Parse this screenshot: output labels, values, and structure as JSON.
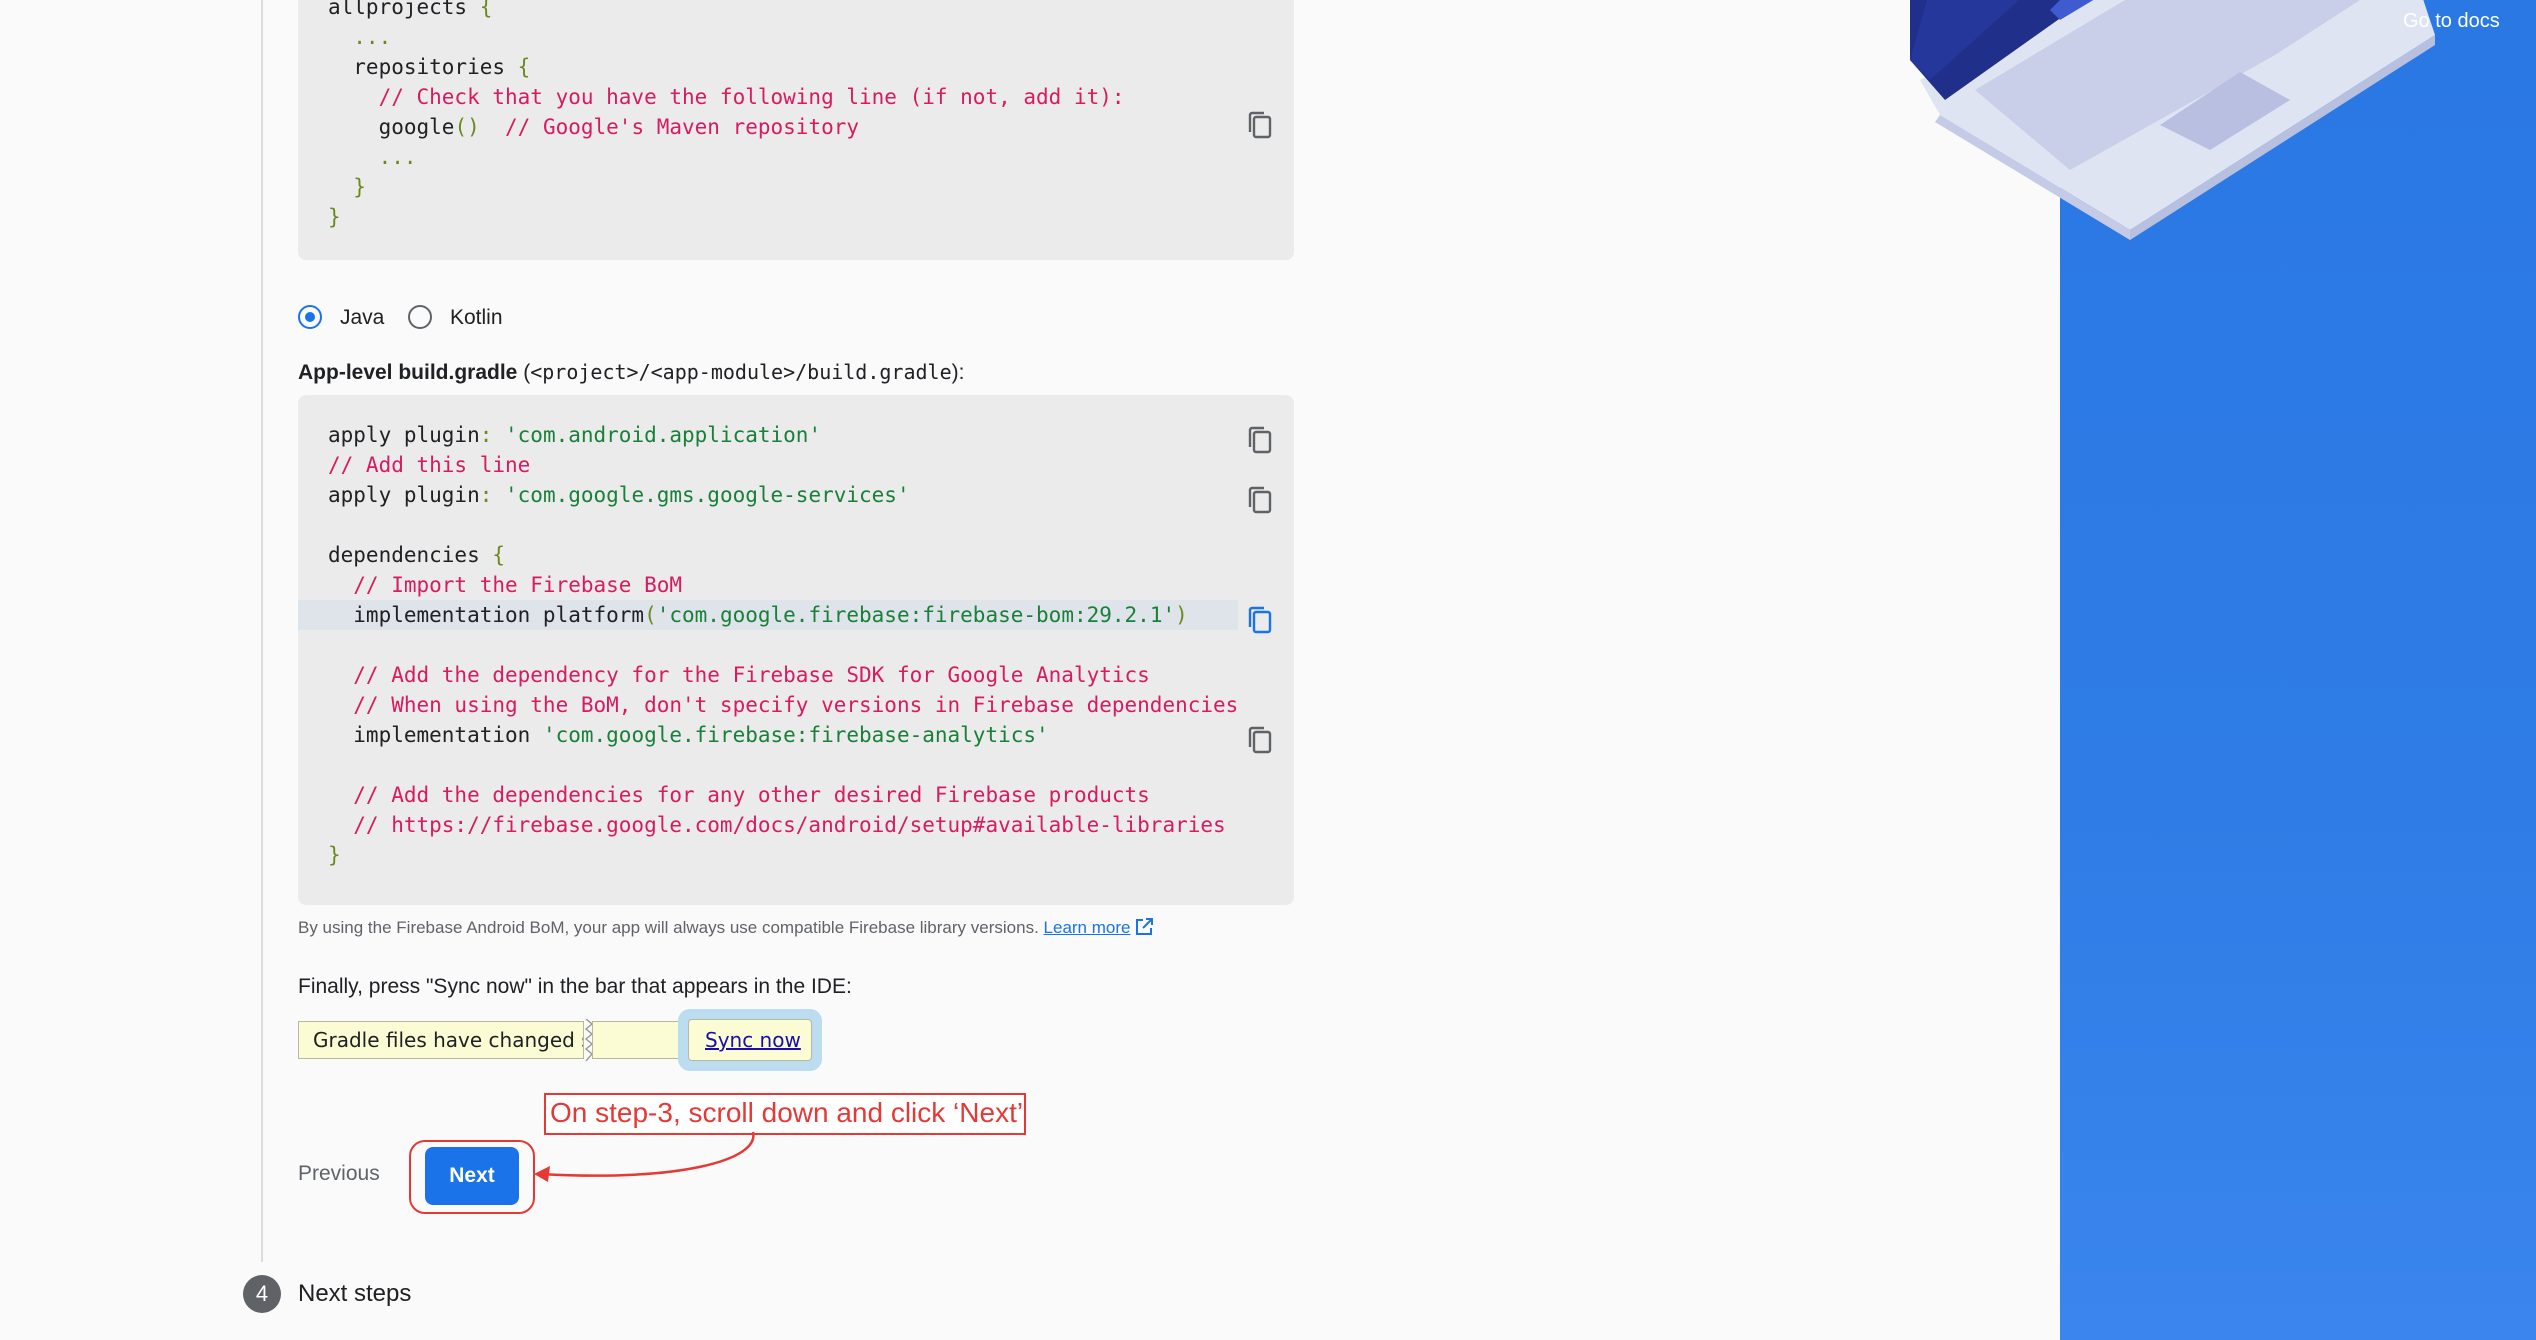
{
  "header": {
    "goto_docs": "Go to docs"
  },
  "code_top": {
    "lines": [
      {
        "parts": [
          {
            "t": "allprojects ",
            "c": ""
          },
          {
            "t": "{",
            "c": "c-punct"
          }
        ]
      },
      {
        "parts": [
          {
            "t": "  ...",
            "c": "c-dim"
          }
        ]
      },
      {
        "parts": [
          {
            "t": "  repositories ",
            "c": ""
          },
          {
            "t": "{",
            "c": "c-punct"
          }
        ]
      },
      {
        "parts": [
          {
            "t": "    // Check that you have the following line (if not, add it):",
            "c": "c-comment"
          }
        ]
      },
      {
        "parts": [
          {
            "t": "    google",
            "c": ""
          },
          {
            "t": "()",
            "c": "c-punct"
          },
          {
            "t": "  // Google's Maven repository",
            "c": "c-comment"
          }
        ]
      },
      {
        "parts": [
          {
            "t": "    ...",
            "c": "c-dim"
          }
        ]
      },
      {
        "parts": [
          {
            "t": "  }",
            "c": "c-punct"
          }
        ]
      },
      {
        "parts": [
          {
            "t": "}",
            "c": "c-punct"
          }
        ]
      }
    ]
  },
  "language": {
    "options": [
      "Java",
      "Kotlin"
    ],
    "selected": "Java"
  },
  "app_gradle_label": {
    "bold": "App-level build.gradle",
    "open": " (",
    "path": "<project>/<app-module>/build.gradle",
    "close": "):"
  },
  "code_app": {
    "lines": [
      {
        "parts": [
          {
            "t": "apply plugin",
            "c": ""
          },
          {
            "t": ": ",
            "c": "c-punct"
          },
          {
            "t": "'com.android.application'",
            "c": "c-string"
          }
        ]
      },
      {
        "parts": [
          {
            "t": "// Add this line",
            "c": "c-comment"
          }
        ]
      },
      {
        "parts": [
          {
            "t": "apply plugin",
            "c": ""
          },
          {
            "t": ": ",
            "c": "c-punct"
          },
          {
            "t": "'com.google.gms.google-services'",
            "c": "c-string"
          }
        ]
      },
      {
        "parts": [
          {
            "t": "",
            "c": ""
          }
        ]
      },
      {
        "parts": [
          {
            "t": "dependencies ",
            "c": ""
          },
          {
            "t": "{",
            "c": "c-punct"
          }
        ]
      },
      {
        "parts": [
          {
            "t": "  // Import the Firebase BoM",
            "c": "c-comment"
          }
        ]
      },
      {
        "parts": [
          {
            "t": "  implementation platform",
            "c": ""
          },
          {
            "t": "(",
            "c": "c-punct"
          },
          {
            "t": "'com.google.firebase:firebase-bom:29.2.1'",
            "c": "c-string"
          },
          {
            "t": ")",
            "c": "c-punct"
          }
        ]
      },
      {
        "parts": [
          {
            "t": "",
            "c": ""
          }
        ]
      },
      {
        "parts": [
          {
            "t": "  // Add the dependency for the Firebase SDK for Google Analytics",
            "c": "c-comment"
          }
        ]
      },
      {
        "parts": [
          {
            "t": "  // When using the BoM, don't specify versions in Firebase dependencies",
            "c": "c-comment"
          }
        ]
      },
      {
        "parts": [
          {
            "t": "  implementation ",
            "c": ""
          },
          {
            "t": "'com.google.firebase:firebase-analytics'",
            "c": "c-string"
          }
        ]
      },
      {
        "parts": [
          {
            "t": "",
            "c": ""
          }
        ]
      },
      {
        "parts": [
          {
            "t": "  // Add the dependencies for any other desired Firebase products",
            "c": "c-comment"
          }
        ]
      },
      {
        "parts": [
          {
            "t": "  // https://firebase.google.com/docs/android/setup#available-libraries",
            "c": "c-comment"
          }
        ]
      },
      {
        "parts": [
          {
            "t": "}",
            "c": "c-punct"
          }
        ]
      }
    ],
    "highlighted_line": 7
  },
  "bom_note": {
    "text": "By using the Firebase Android BoM, your app will always use compatible Firebase library versions.",
    "link": "Learn more"
  },
  "sync_instruction": "Finally, press \"Sync now\" in the bar that appears in the IDE:",
  "ide_bar": {
    "message": "Gradle files have changed since last project sync",
    "sync_link": "Sync now"
  },
  "annotation": {
    "text": "On step-3, scroll down and click ‘Next’",
    "color": "#e53935"
  },
  "nav": {
    "previous": "Previous",
    "next": "Next"
  },
  "next_step": {
    "number": "4",
    "title": "Next steps"
  },
  "colors": {
    "accent": "#1a73e8",
    "panel": "#2a78e4"
  }
}
